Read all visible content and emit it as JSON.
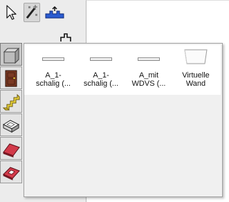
{
  "toolbox": {
    "tools": [
      {
        "icon": "arrow-pointer-icon"
      },
      {
        "icon": "magic-wand-icon"
      },
      {
        "icon": "measure-tool-icon"
      }
    ],
    "categories": [
      {
        "icon": "wall-tool-icon",
        "selected": true
      },
      {
        "icon": "door-tool-icon",
        "selected": false
      },
      {
        "icon": "stair-tool-icon",
        "selected": false
      },
      {
        "icon": "opening-tool-icon",
        "selected": false
      },
      {
        "icon": "roof-tool-icon",
        "selected": false
      },
      {
        "icon": "skylight-tool-icon",
        "selected": false
      }
    ]
  },
  "flyout": {
    "items": [
      {
        "label": "A_1-\nschalig (...",
        "icon": "wall-type-thumbnail"
      },
      {
        "label": "A_1-\nschalig (...",
        "icon": "wall-type-thumbnail"
      },
      {
        "label": "A_mit\nWDVS (...",
        "icon": "wall-type-thumbnail"
      },
      {
        "label": "Virtuelle\nWand",
        "icon": "virtual-wall-thumbnail"
      }
    ]
  },
  "colors": {
    "accent_red": "#d23a4a",
    "accent_yellow": "#e8d23a",
    "door_brown": "#7a3a24"
  }
}
